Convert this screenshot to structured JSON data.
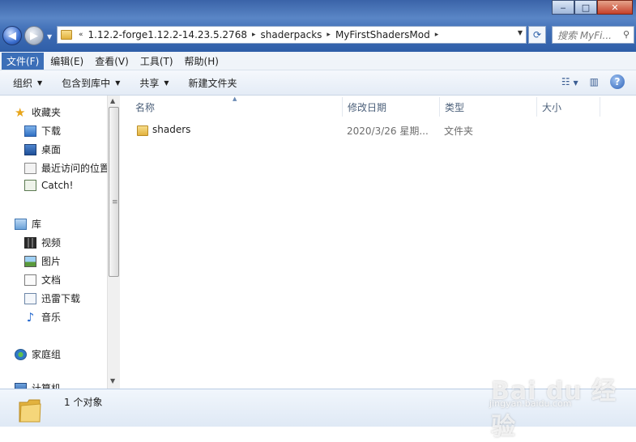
{
  "window": {
    "minimize": "‒",
    "maximize": "□",
    "close": "✕"
  },
  "address": {
    "overflow": "«",
    "crumbs": [
      "1.12.2-forge1.12.2-14.23.5.2768",
      "shaderpacks",
      "MyFirstShadersMod"
    ],
    "separator": "▸"
  },
  "search": {
    "placeholder": "搜索 MyFi..."
  },
  "menubar": {
    "items": [
      "文件(F)",
      "编辑(E)",
      "查看(V)",
      "工具(T)",
      "帮助(H)"
    ],
    "active": "文件(F)"
  },
  "toolbar": {
    "organize": "组织",
    "include_library": "包含到库中",
    "share": "共享",
    "new_folder": "新建文件夹"
  },
  "navpane": {
    "favorites": {
      "label": "收藏夹",
      "items": [
        "下载",
        "桌面",
        "最近访问的位置",
        "Catch!"
      ]
    },
    "library": {
      "label": "库",
      "items": [
        "视频",
        "图片",
        "文档",
        "迅雷下载",
        "音乐"
      ]
    },
    "homegroup": "家庭组",
    "computer": "计算机"
  },
  "columns": {
    "name": "名称",
    "date": "修改日期",
    "type": "类型",
    "size": "大小"
  },
  "files": [
    {
      "name": "shaders",
      "date": "2020/3/26 星期...",
      "type": "文件夹",
      "size": ""
    }
  ],
  "status": {
    "count": "1 个对象"
  },
  "watermark": {
    "brand": "Bai du 经验",
    "url": "jingyan.baidu.com"
  },
  "colors": {
    "accent": "#3c6fb8",
    "titlebar": "#3f6eb6",
    "folder": "#e2b23e"
  }
}
